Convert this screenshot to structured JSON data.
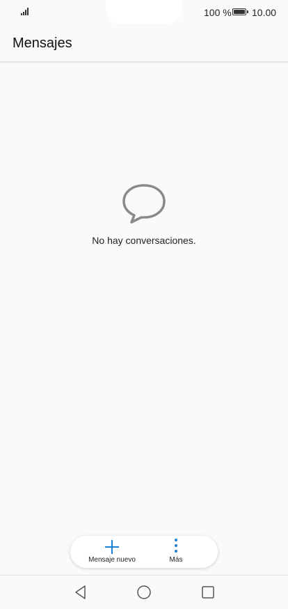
{
  "status_bar": {
    "battery_percent": "100 %",
    "time": "10.00",
    "signal_icon": "signal-bars-icon",
    "battery_icon": "battery-full-icon"
  },
  "header": {
    "title": "Mensajes"
  },
  "empty_state": {
    "icon": "chat-bubble-icon",
    "message": "No hay conversaciones."
  },
  "actions": {
    "new_message_label": "Mensaje nuevo",
    "new_message_icon": "plus-icon",
    "more_label": "Más",
    "more_icon": "more-vertical-icon",
    "accent_color": "#1a7fd9"
  },
  "nav_bar": {
    "back_icon": "back-triangle-icon",
    "home_icon": "home-circle-icon",
    "recents_icon": "recents-square-icon"
  }
}
